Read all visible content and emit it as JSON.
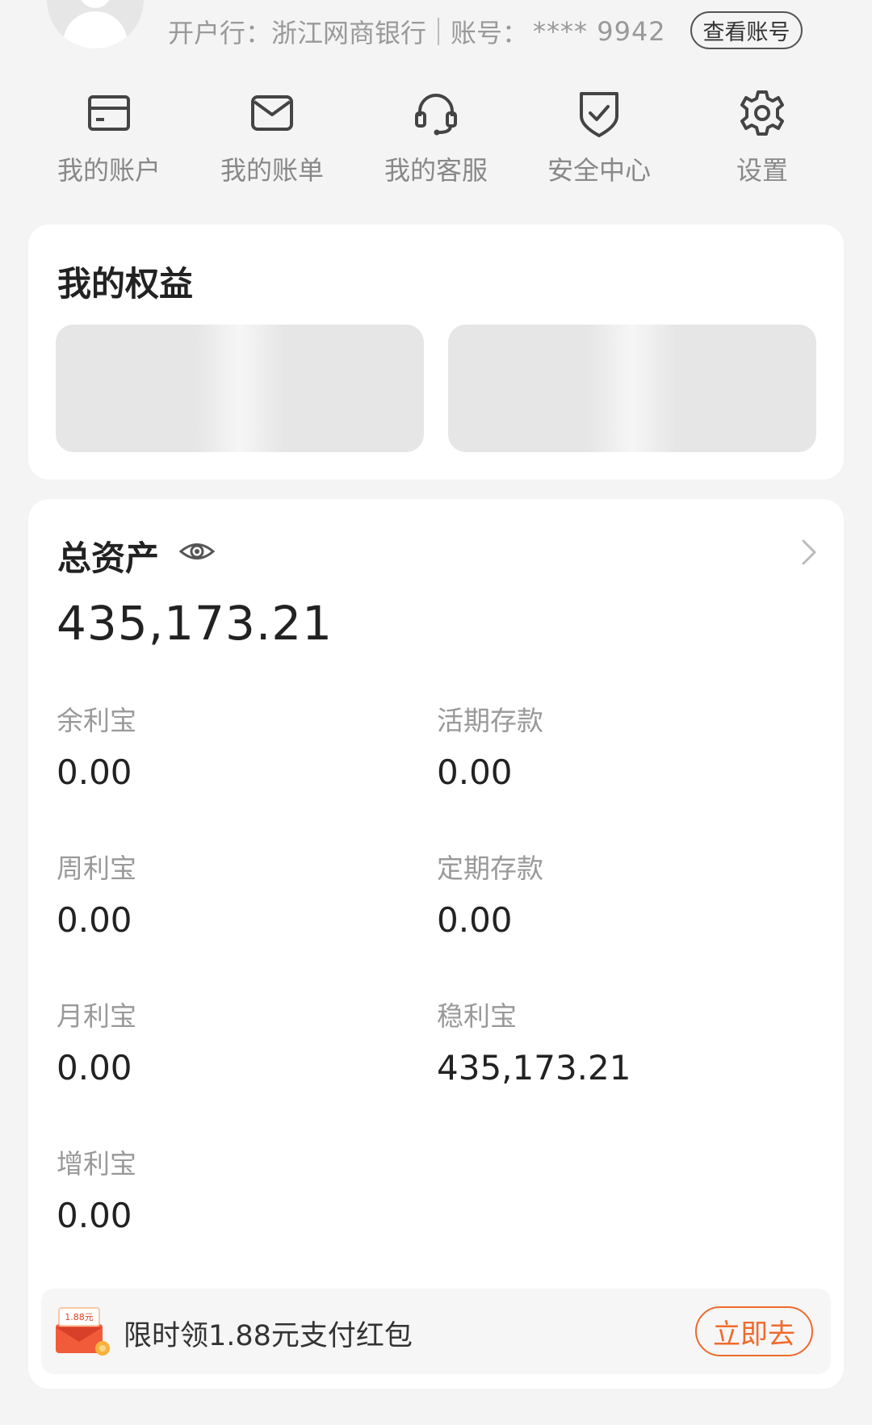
{
  "header": {
    "bank_label": "开户行：",
    "bank_name": "浙江网商银行",
    "account_label": "账号：",
    "account_number": "**** 9942",
    "view_account_button": "查看账号"
  },
  "quick_nav": [
    {
      "label": "我的账户",
      "icon": "card-icon"
    },
    {
      "label": "我的账单",
      "icon": "envelope-icon"
    },
    {
      "label": "我的客服",
      "icon": "headset-icon"
    },
    {
      "label": "安全中心",
      "icon": "shield-check-icon"
    },
    {
      "label": "设置",
      "icon": "gear-icon"
    }
  ],
  "benefits": {
    "title": "我的权益"
  },
  "assets": {
    "title": "总资产",
    "total": "435,173.21",
    "items": [
      {
        "label": "余利宝",
        "value": "0.00"
      },
      {
        "label": "活期存款",
        "value": "0.00"
      },
      {
        "label": "周利宝",
        "value": "0.00"
      },
      {
        "label": "定期存款",
        "value": "0.00"
      },
      {
        "label": "月利宝",
        "value": "0.00"
      },
      {
        "label": "稳利宝",
        "value": "435,173.21"
      },
      {
        "label": "增利宝",
        "value": "0.00"
      }
    ]
  },
  "promo": {
    "text": "限时领1.88元支付红包",
    "badge": "1.88元",
    "button": "立即去"
  },
  "colors": {
    "accent": "#f06a2c",
    "background": "#f4f4f4",
    "card": "#ffffff"
  }
}
